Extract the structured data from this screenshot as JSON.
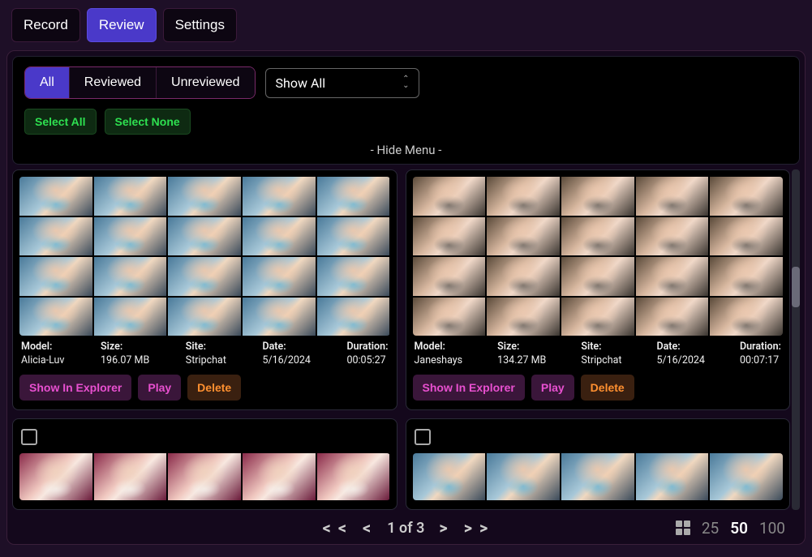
{
  "tabs": {
    "record": "Record",
    "review": "Review",
    "settings": "Settings",
    "active": "review"
  },
  "filter": {
    "seg": {
      "all": "All",
      "reviewed": "Reviewed",
      "unreviewed": "Unreviewed",
      "active": "all"
    },
    "dropdown": "Show All",
    "select_all": "Select All",
    "select_none": "Select None",
    "hide_menu": "- Hide Menu -"
  },
  "meta_labels": {
    "model": "Model:",
    "size": "Size:",
    "site": "Site:",
    "date": "Date:",
    "duration": "Duration:"
  },
  "actions": {
    "explorer": "Show In Explorer",
    "play": "Play",
    "delete": "Delete"
  },
  "cards": [
    {
      "model": "Alicia-Luv",
      "size": "196.07 MB",
      "site": "Stripchat",
      "date": "5/16/2024",
      "duration": "00:05:27",
      "style": "a"
    },
    {
      "model": "Janeshays",
      "size": "134.27 MB",
      "site": "Stripchat",
      "date": "5/16/2024",
      "duration": "00:07:17",
      "style": "b"
    }
  ],
  "pager": {
    "first": "< <",
    "prev": "<",
    "page": "1 of 3",
    "next": ">",
    "last": "> >"
  },
  "page_sizes": {
    "s25": "25",
    "s50": "50",
    "s100": "100",
    "active": "50"
  }
}
